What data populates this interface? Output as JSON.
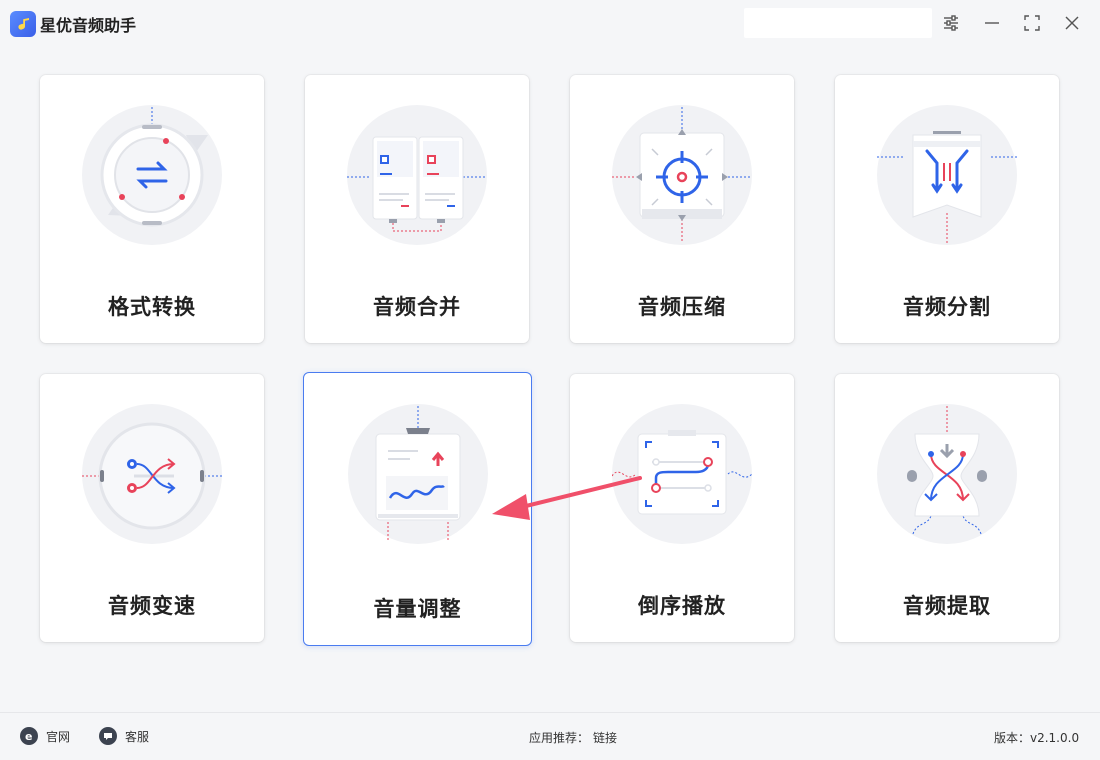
{
  "app": {
    "title": "星优音频助手",
    "logo_icon": "music-note-icon",
    "accent": "#3a6df0"
  },
  "window_controls": [
    {
      "name": "settings-sliders-icon"
    },
    {
      "name": "minimize-icon"
    },
    {
      "name": "maximize-icon"
    },
    {
      "name": "close-icon"
    }
  ],
  "features": [
    {
      "label": "格式转换",
      "icon": "format-convert-icon"
    },
    {
      "label": "音频合并",
      "icon": "audio-merge-icon"
    },
    {
      "label": "音频压缩",
      "icon": "audio-compress-icon"
    },
    {
      "label": "音频分割",
      "icon": "audio-split-icon"
    },
    {
      "label": "音频变速",
      "icon": "audio-speed-icon"
    },
    {
      "label": "音量调整",
      "icon": "volume-adjust-icon",
      "selected": true
    },
    {
      "label": "倒序播放",
      "icon": "reverse-play-icon"
    },
    {
      "label": "音频提取",
      "icon": "audio-extract-icon"
    }
  ],
  "footer": {
    "website": "官网",
    "support": "客服",
    "recommend_label": "应用推荐：",
    "recommend_link": "链接",
    "version": "版本：v2.1.0.0"
  },
  "colors": {
    "blue": "#2f64e8",
    "red": "#e8435a",
    "arrow": "#f0506a"
  }
}
